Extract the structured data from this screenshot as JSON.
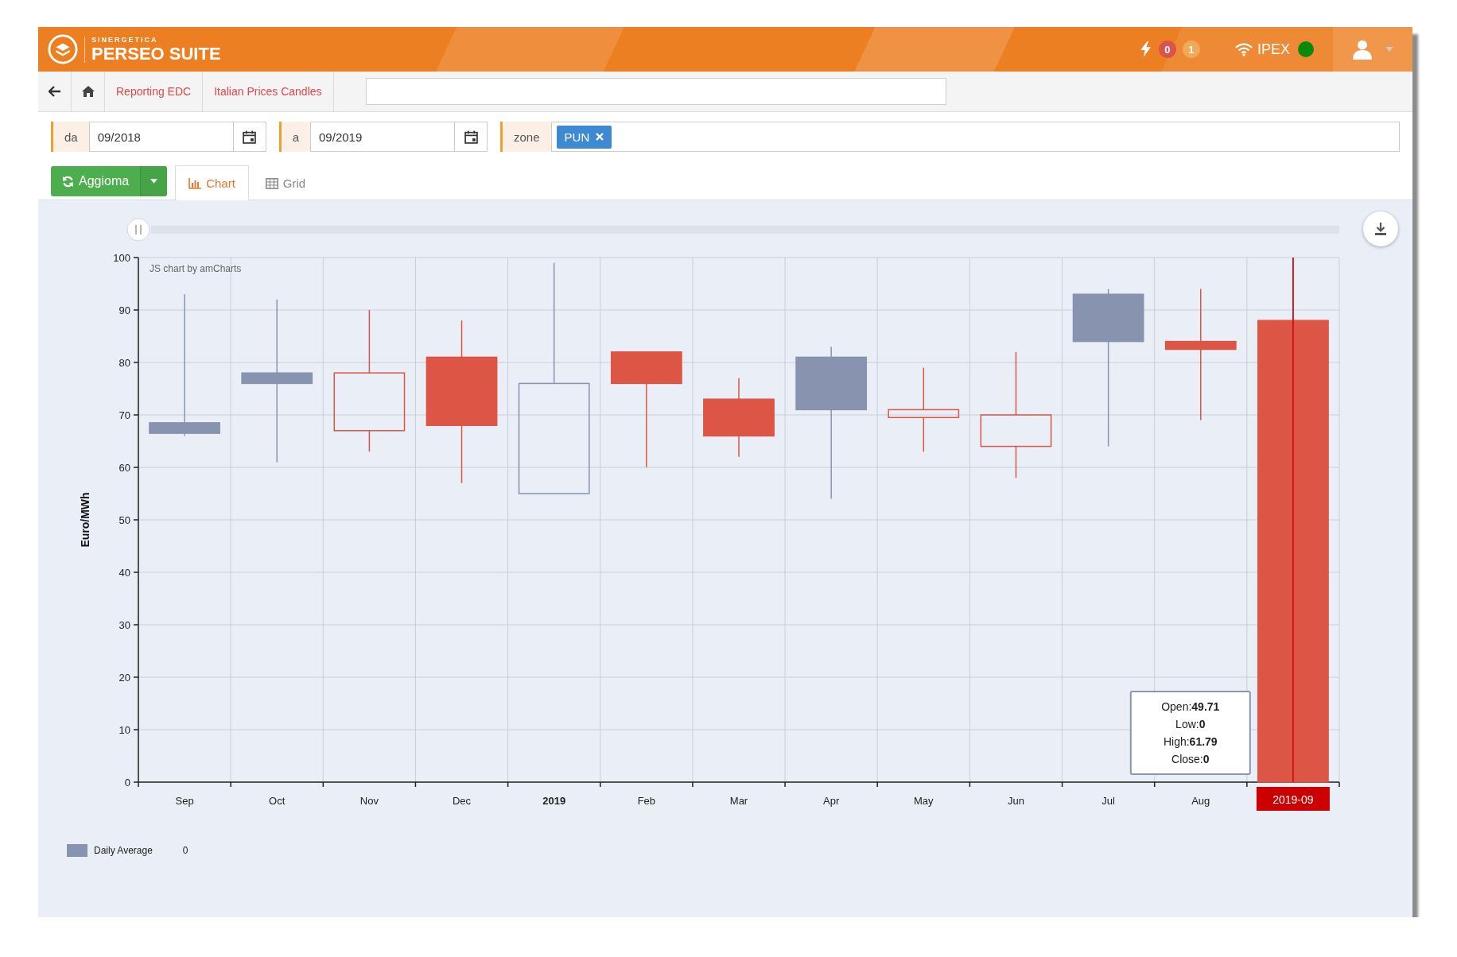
{
  "header": {
    "logo": {
      "brand": "SINERGETICA",
      "product": "PERSEO SUITE"
    },
    "alerts": [
      {
        "count": "0",
        "color": "#d9534f"
      },
      {
        "count": "1",
        "color": "#f0a954"
      }
    ],
    "connection": {
      "label": "IPEX",
      "online": true
    }
  },
  "breadcrumb": [
    {
      "kind": "back"
    },
    {
      "kind": "home"
    },
    {
      "kind": "link",
      "label": "Reporting EDC"
    },
    {
      "kind": "link",
      "label": "Italian Prices Candles"
    }
  ],
  "filters": [
    {
      "kind": "date",
      "label": "da",
      "value": "09/2018"
    },
    {
      "kind": "date",
      "label": "a",
      "value": "09/2019"
    },
    {
      "kind": "tags",
      "label": "zone",
      "tags": [
        "PUN"
      ]
    }
  ],
  "toolbar": {
    "refresh_button": {
      "label": "Aggioma"
    },
    "tabs": [
      {
        "kind": "chart",
        "label": "Chart",
        "selected": true
      },
      {
        "kind": "grid",
        "label": "Grid",
        "selected": false
      }
    ]
  },
  "chart": {
    "credit": "JS chart by amCharts",
    "ylabel": "Euro/MWh",
    "yticks": [
      "100",
      "90",
      "80",
      "70",
      "60",
      "50",
      "40",
      "30",
      "20",
      "10",
      "0"
    ],
    "candles": [
      {
        "label": "Sep",
        "label_bold": false,
        "color": "#8893b0",
        "filled": true,
        "hovered": false
      },
      {
        "label": "Oct",
        "label_bold": false,
        "color": "#8893b0",
        "filled": true,
        "hovered": false
      },
      {
        "label": "Nov",
        "label_bold": false,
        "color": "#dd5545",
        "filled": false,
        "hovered": false
      },
      {
        "label": "Dec",
        "label_bold": false,
        "color": "#dd5545",
        "filled": true,
        "hovered": false
      },
      {
        "label": "2019",
        "label_bold": true,
        "color": "#8893b0",
        "filled": false,
        "hovered": false
      },
      {
        "label": "Feb",
        "label_bold": false,
        "color": "#dd5545",
        "filled": true,
        "hovered": false
      },
      {
        "label": "Mar",
        "label_bold": false,
        "color": "#dd5545",
        "filled": true,
        "hovered": false
      },
      {
        "label": "Apr",
        "label_bold": false,
        "color": "#8893b0",
        "filled": true,
        "hovered": false
      },
      {
        "label": "May",
        "label_bold": false,
        "color": "#dd5545",
        "filled": false,
        "hovered": false
      },
      {
        "label": "Jun",
        "label_bold": false,
        "color": "#dd5545",
        "filled": false,
        "hovered": false
      },
      {
        "label": "Jul",
        "label_bold": false,
        "color": "#8893b0",
        "filled": true,
        "hovered": false
      },
      {
        "label": "Aug",
        "label_bold": false,
        "color": "#dd5545",
        "filled": true,
        "hovered": false
      },
      {
        "label": "2019-09",
        "label_bold": false,
        "color": "#dd5545",
        "filled": true,
        "hovered": true
      }
    ],
    "tooltip": [
      {
        "label": "Open:",
        "value": "49.71"
      },
      {
        "label": "Low:",
        "value": "0"
      },
      {
        "label": "High:",
        "value": "61.79"
      },
      {
        "label": "Close:",
        "value": "0"
      }
    ],
    "legend": [
      {
        "label": "Daily Average",
        "value": "0",
        "color": "#8893b0"
      }
    ]
  }
}
